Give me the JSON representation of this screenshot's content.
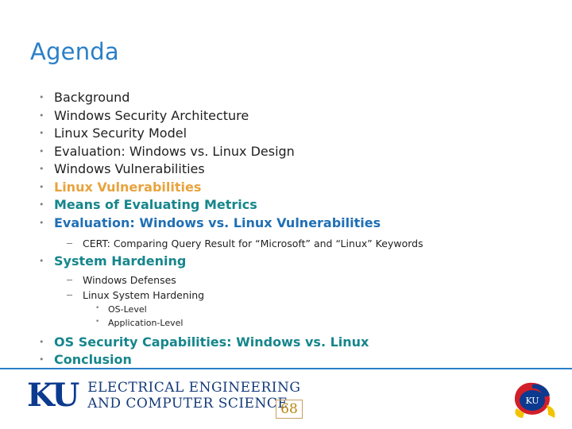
{
  "slide": {
    "title": "Agenda",
    "bullets": [
      {
        "text": "Background",
        "style": "plain"
      },
      {
        "text": "Windows Security Architecture",
        "style": "plain"
      },
      {
        "text": "Linux Security Model",
        "style": "plain"
      },
      {
        "text": "Evaluation: Windows vs. Linux Design",
        "style": "plain"
      },
      {
        "text": "Windows Vulnerabilities",
        "style": "plain"
      },
      {
        "text": "Linux Vulnerabilities",
        "style": "orange"
      },
      {
        "text": "Means of Evaluating Metrics",
        "style": "teal"
      },
      {
        "text": "Evaluation: Windows vs. Linux Vulnerabilities",
        "style": "bluebold"
      },
      {
        "text": "System Hardening",
        "style": "teal"
      },
      {
        "text": "OS Security Capabilities: Windows vs. Linux",
        "style": "teal"
      },
      {
        "text": "Conclusion",
        "style": "teal"
      }
    ],
    "sub_after_eval_vuln": [
      "CERT: Comparing Query Result for “Microsoft” and “Linux” Keywords"
    ],
    "sub_after_hardening": [
      "Windows Defenses",
      "Linux System Hardening"
    ],
    "sub_sub_hardening": [
      "OS-Level",
      "Application-Level"
    ]
  },
  "footer": {
    "logo_mark": "KU",
    "logo_line1": "ELECTRICAL ENGINEERING",
    "logo_line2": "AND COMPUTER SCIENCE",
    "page_number": "68",
    "jayhawk_label": "KU"
  },
  "colors": {
    "title": "#2a7fc9",
    "orange": "#E8A33D",
    "teal": "#16868C",
    "blue": "#1F6FB5",
    "rule": "#2a7fc9",
    "logo_blue": "#0b3a8f",
    "page_number": "#b8860b"
  }
}
